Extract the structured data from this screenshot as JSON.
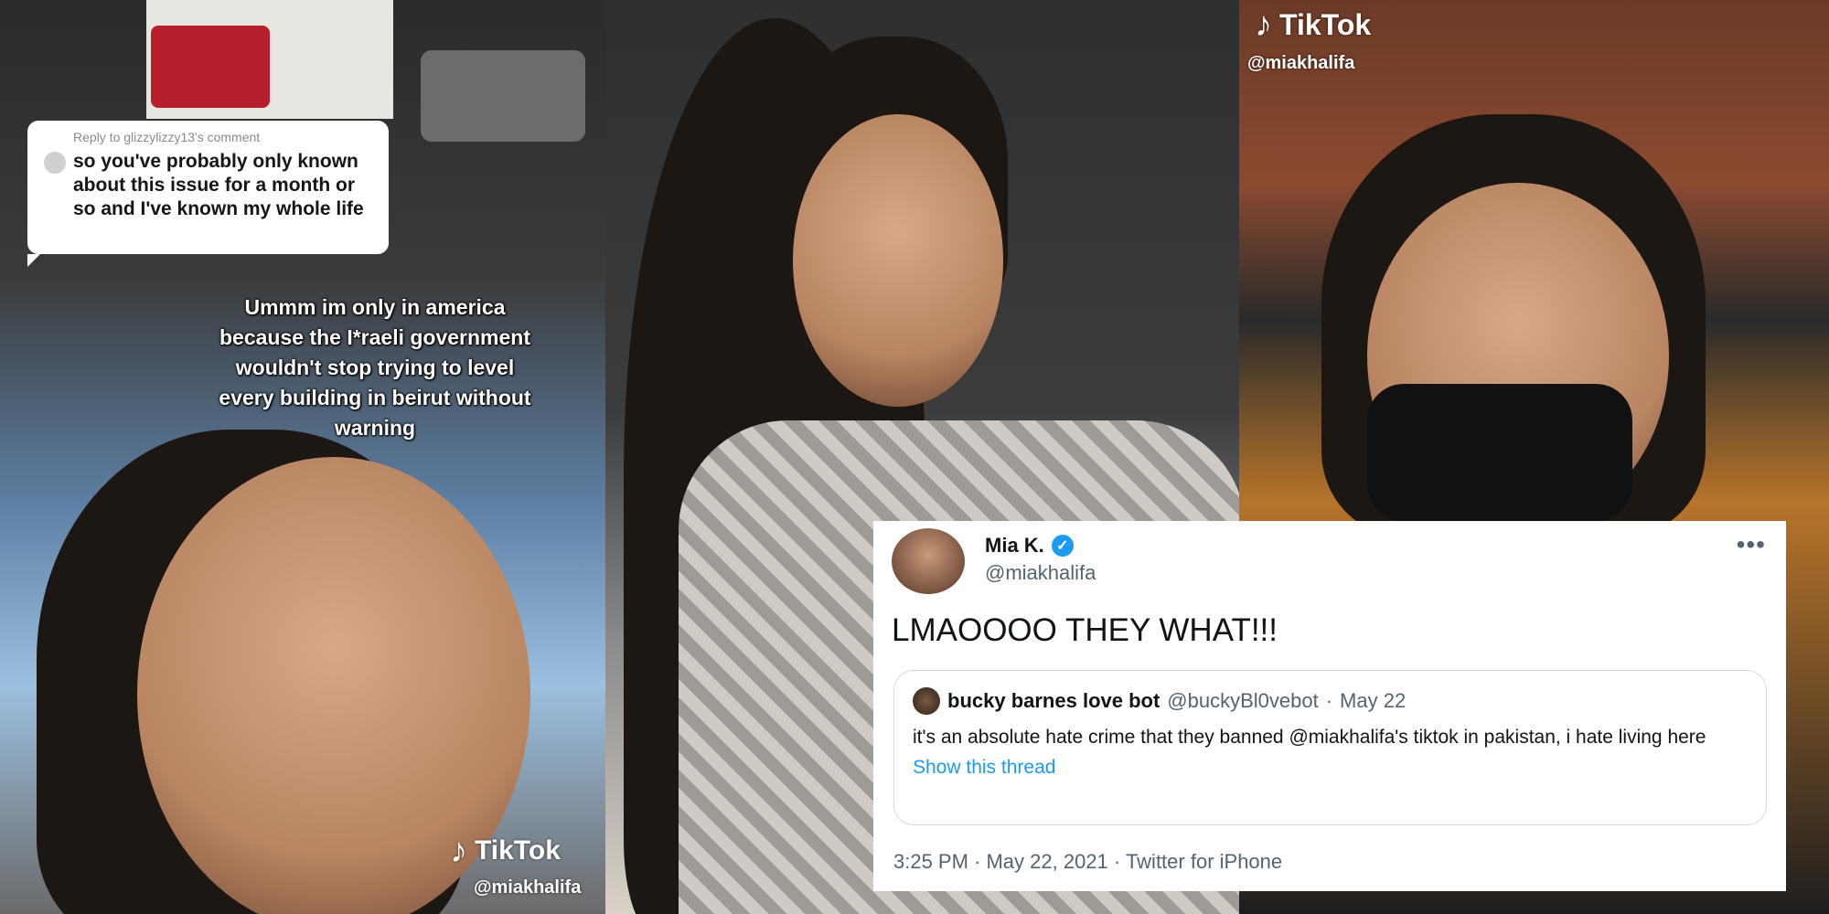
{
  "left_panel": {
    "comment": {
      "reply_to": "Reply to glizzylizzy13's comment",
      "text": "so you've probably only known about this issue for a month or so and I've known my whole life"
    },
    "caption": "Ummm im only in america because the I*raeli government wouldn't stop trying to level every building in beirut without warning",
    "tiktok_logo": "TikTok",
    "handle": "@miakhalifa"
  },
  "right_panel": {
    "tiktok_logo": "TikTok",
    "handle": "@miakhalifa"
  },
  "tweet": {
    "author_name": "Mia K.",
    "author_handle": "@miakhalifa",
    "text": "LMAOOOO THEY WHAT!!!",
    "quote": {
      "author_name": "bucky barnes love bot",
      "author_handle": "@buckyBl0vebot",
      "separator": "·",
      "date": "May 22",
      "text": "it's an absolute hate crime that they banned @miakhalifa's tiktok in pakistan, i hate living here",
      "show_thread": "Show this thread"
    },
    "timestamp": "3:25 PM · May 22, 2021 · Twitter for iPhone"
  },
  "colors": {
    "link_blue": "#1d9bf0",
    "verified_blue": "#1d9bf0",
    "secondary_text": "#536471"
  },
  "icons": {
    "verified": "verified-badge-icon",
    "more": "more-options-icon",
    "tiktok": "tiktok-note-icon"
  }
}
